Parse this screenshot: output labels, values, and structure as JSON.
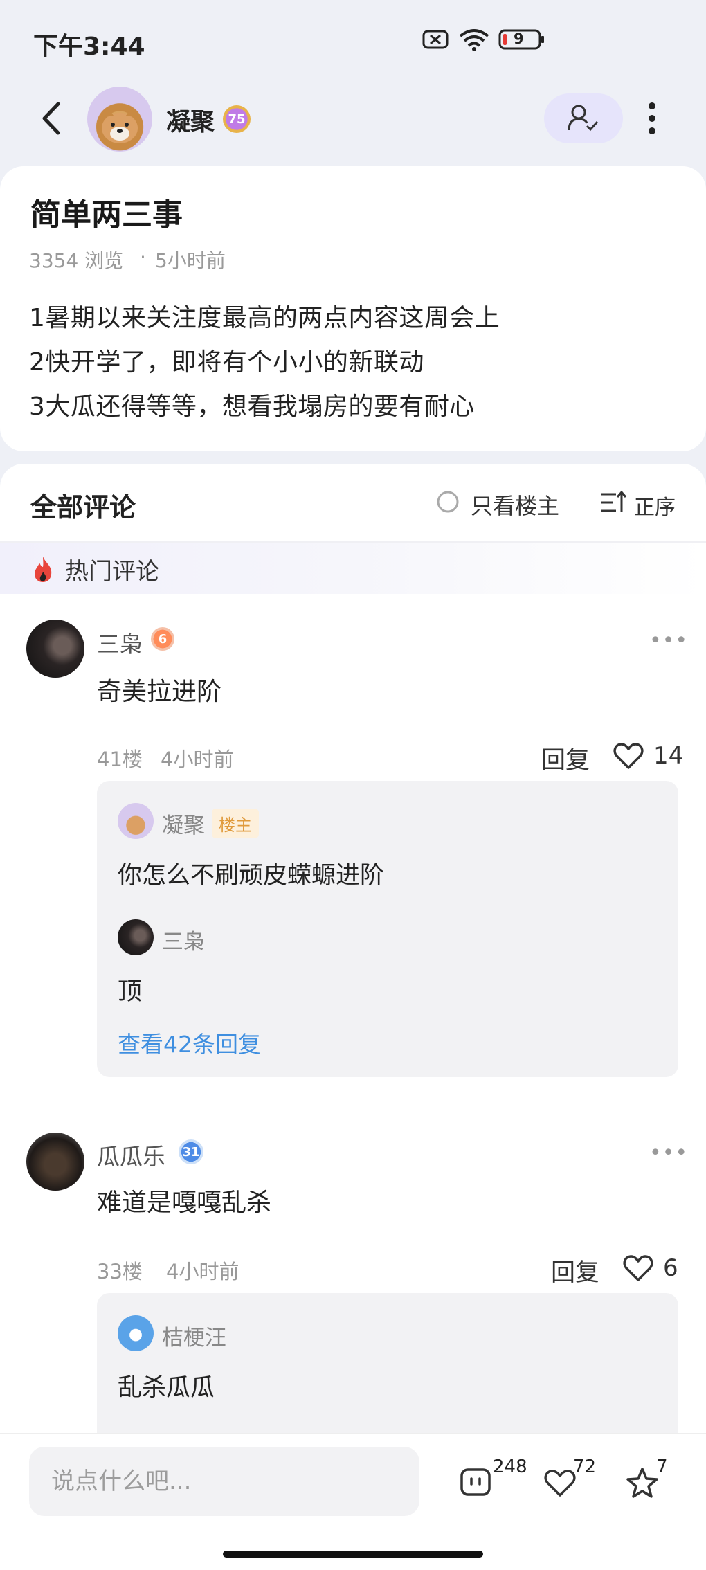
{
  "status_bar": {
    "time": "下午3:44",
    "battery": "9"
  },
  "header": {
    "author_name": "凝聚",
    "author_level": "75"
  },
  "post": {
    "title": "简单两三事",
    "views": "3354 浏览",
    "separator": "·",
    "time": "5小时前",
    "content_lines": [
      "1暑期以来关注度最高的两点内容这周会上",
      "2快开学了，即将有个小小的新联动",
      "3大瓜还得等等，想看我塌房的要有耐心"
    ]
  },
  "comments_section": {
    "title": "全部评论",
    "only_owner_label": "只看楼主",
    "sort_label": "正序",
    "hot_label": "热门评论"
  },
  "comments": [
    {
      "user": "三枭",
      "level": "6",
      "text": "奇美拉进阶",
      "floor": "41楼",
      "time": "4小时前",
      "reply_label": "回复",
      "likes": "14",
      "replies": [
        {
          "user": "凝聚",
          "tag": "楼主",
          "text": "你怎么不刷顽皮蝾螈进阶"
        },
        {
          "user": "三枭",
          "text": "顶"
        }
      ],
      "view_more": "查看42条回复"
    },
    {
      "user": "瓜瓜乐",
      "level": "31",
      "text": "难道是嘎嘎乱杀",
      "floor": "33楼",
      "time": "4小时前",
      "reply_label": "回复",
      "likes": "6",
      "replies": [
        {
          "user": "桔梗汪",
          "text": "乱杀瓜瓜"
        }
      ]
    }
  ],
  "bottom_bar": {
    "placeholder": "说点什么吧...",
    "comment_count": "248",
    "like_count": "72",
    "star_count": "7"
  },
  "colors": {
    "background": "#eef0f6",
    "follow_button": "#e6e4fb",
    "link_blue": "#3f8fe0",
    "owner_tag": "#e09a3c"
  },
  "icons": [
    "back-icon",
    "follow-icon",
    "more-vert-icon",
    "fire-icon",
    "sort-icon",
    "heart-icon",
    "comment-icon",
    "star-icon"
  ]
}
